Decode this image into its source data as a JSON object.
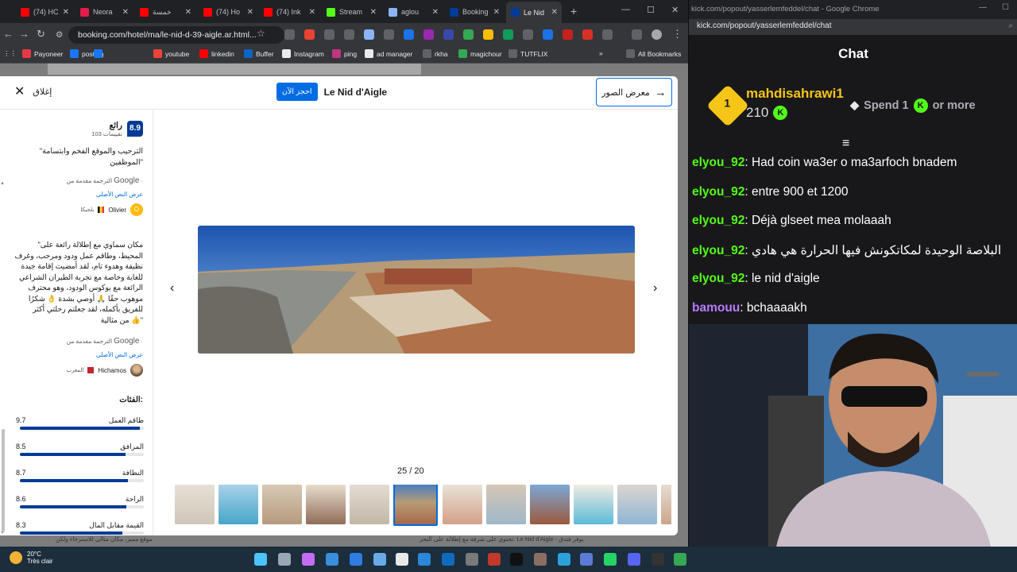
{
  "browser": {
    "tabs": [
      {
        "label": "(74) HC",
        "color": "#ff0000"
      },
      {
        "label": "Neora",
        "color": "#e11d48"
      },
      {
        "label": "خمسة",
        "color": "#ff0000"
      },
      {
        "label": "(74) Ho",
        "color": "#ff0000"
      },
      {
        "label": "(74) Ink",
        "color": "#ff0000"
      },
      {
        "label": "Stream",
        "color": "#53fc18"
      },
      {
        "label": "aglou",
        "color": "#8ab4f8"
      },
      {
        "label": "Booking",
        "color": "#003b95"
      },
      {
        "label": "Le Nid",
        "color": "#003b95"
      }
    ],
    "url": "booking.com/hotel/ma/le-nid-d-39-aigle.ar.html...",
    "bookmarks": [
      "Payoneer",
      "posting",
      "youtube",
      "linkedin",
      "Buffer",
      "Instagram",
      "ping",
      "ad manager",
      "rkha",
      "magichour",
      "TUTFLIX",
      "All Bookmarks"
    ]
  },
  "modal": {
    "close_label": "إغلاق",
    "book_label": "احجز الآن",
    "hotel_name": "Le Nid d'Aigle",
    "gallery_label": "معرض الصور",
    "score": "8.9",
    "score_word": "رائع",
    "review_count": "103 تقييمات",
    "review1_tail": [
      "\"الترحيب والموقع الفخم وابتسامة",
      "الموظفين\""
    ],
    "translated_by": "الترجمة مقدمة من",
    "google": "Google",
    "show_original": "عرض النص الأصلي",
    "author1": {
      "name": "Olivier",
      "country": "بلجيكا",
      "initial": "O"
    },
    "review2": [
      "\"مكان سماوي مع إطلالة رائعة على",
      "المحيط، وطاقم عمل ودود ومرحب، وغرف",
      "نظيفة وهدوء تام، لقد أمضيت إقامة جيدة",
      "للغاية وخاصة مع تجربة الطيران الشراعي",
      "الرائعة مع يوكوس الودود، وهو محترف",
      "موهوب حقًا 🙏 أوصي بشدة 👌 شكرًا",
      "للفريق بأكمله، لقد جعلتم رحلتي أكثر",
      "من مثالية 👍\""
    ],
    "author2": {
      "name": "Hichamos",
      "country": "المغرب"
    },
    "categories_title": "الفئات:",
    "categories": [
      {
        "label": "طاقم العمل",
        "value": "9.7",
        "score": 9.7
      },
      {
        "label": "المرافق",
        "value": "8.5",
        "score": 8.5
      },
      {
        "label": "النظافة",
        "value": "8.7",
        "score": 8.7
      },
      {
        "label": "الراحة",
        "value": "8.6",
        "score": 8.6
      },
      {
        "label": "القيمة مقابل المال",
        "value": "8.3",
        "score": 8.3
      }
    ],
    "counter": "25 / 20",
    "behind_text_left": "موقع مميز، مكان مثالي للاسترخاء ولكن",
    "behind_text_right": "تحتوي على شرفة مع إطلالة على البحر. Le Nid d'Aigle - يوفر فندق"
  },
  "chat": {
    "window_title": "kick.com/popout/yasserlemfeddel/chat - Google Chrome",
    "url": "kick.com/popout/yasserlemfeddel/chat",
    "header": "Chat",
    "pinned": {
      "rank": "1",
      "user": "mahdisahrawi1",
      "amount": "210",
      "spend": "Spend 1",
      "more": "or more"
    },
    "messages": [
      {
        "user": "elyou_92",
        "text": ": Had coin wa3er o ma3arfoch bnadem",
        "color": "#53fc18"
      },
      {
        "user": "elyou_92",
        "text": ": entre 900 et 1200",
        "color": "#53fc18"
      },
      {
        "user": "elyou_92",
        "text": ": Déjà glseet mea molaaah",
        "color": "#53fc18"
      },
      {
        "user": "elyou_92",
        "text": ": البلاصة الوحيدة لمكاتكونش فيها الحرارة هي هادي",
        "color": "#53fc18"
      },
      {
        "user": "elyou_92",
        "text": ": le nid d'aigle",
        "color": "#53fc18"
      },
      {
        "user": "bamouu",
        "text": ": bchaaaakh",
        "color": "#b57cff"
      }
    ]
  },
  "taskbar": {
    "temp": "20°C",
    "weather": "Très clair"
  }
}
